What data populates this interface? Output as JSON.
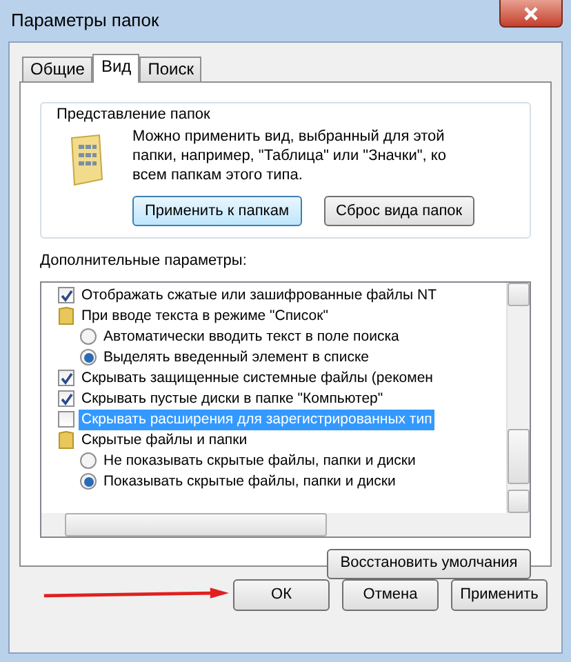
{
  "window": {
    "title": "Параметры папок"
  },
  "tabs": [
    {
      "label": "Общие",
      "selected": false
    },
    {
      "label": "Вид",
      "selected": true
    },
    {
      "label": "Поиск",
      "selected": false
    }
  ],
  "folder_views": {
    "title": "Представление папок",
    "description": "Можно применить вид, выбранный для этой папки, например, \"Таблица\" или \"Значки\", ко всем папкам этого типа.",
    "buttons": [
      {
        "label": "Применить к папкам",
        "focused": true
      },
      {
        "label": "Сброс вида папок",
        "focused": false
      }
    ]
  },
  "advanced": {
    "label": "Дополнительные параметры:",
    "items": [
      {
        "kind": "checkbox",
        "label": "Отображать сжатые или зашифрованные файлы NT",
        "checked": true,
        "selected": false
      },
      {
        "kind": "folder",
        "label": "При вводе текста в режиме \"Список\"",
        "selected": false,
        "children": [
          {
            "kind": "radio",
            "label": "Автоматически вводить текст в поле поиска",
            "checked": false,
            "selected": false
          },
          {
            "kind": "radio",
            "label": "Выделять введенный элемент в списке",
            "checked": true,
            "selected": false
          }
        ]
      },
      {
        "kind": "checkbox",
        "label": "Скрывать защищенные системные файлы (рекомен",
        "checked": true,
        "selected": false
      },
      {
        "kind": "checkbox",
        "label": "Скрывать пустые диски в папке \"Компьютер\"",
        "checked": true,
        "selected": false
      },
      {
        "kind": "checkbox",
        "label": "Скрывать расширения для зарегистрированных тип",
        "checked": false,
        "selected": true
      },
      {
        "kind": "folder",
        "label": "Скрытые файлы и папки",
        "selected": false,
        "children": [
          {
            "kind": "radio",
            "label": "Не показывать скрытые файлы, папки и диски",
            "checked": false,
            "selected": false
          },
          {
            "kind": "radio",
            "label": "Показывать скрытые файлы, папки и диски",
            "checked": true,
            "selected": false
          }
        ]
      }
    ],
    "restore_button": "Восстановить умолчания"
  },
  "buttons": [
    {
      "label": "ОК"
    },
    {
      "label": "Отмена"
    },
    {
      "label": "Применить"
    }
  ]
}
